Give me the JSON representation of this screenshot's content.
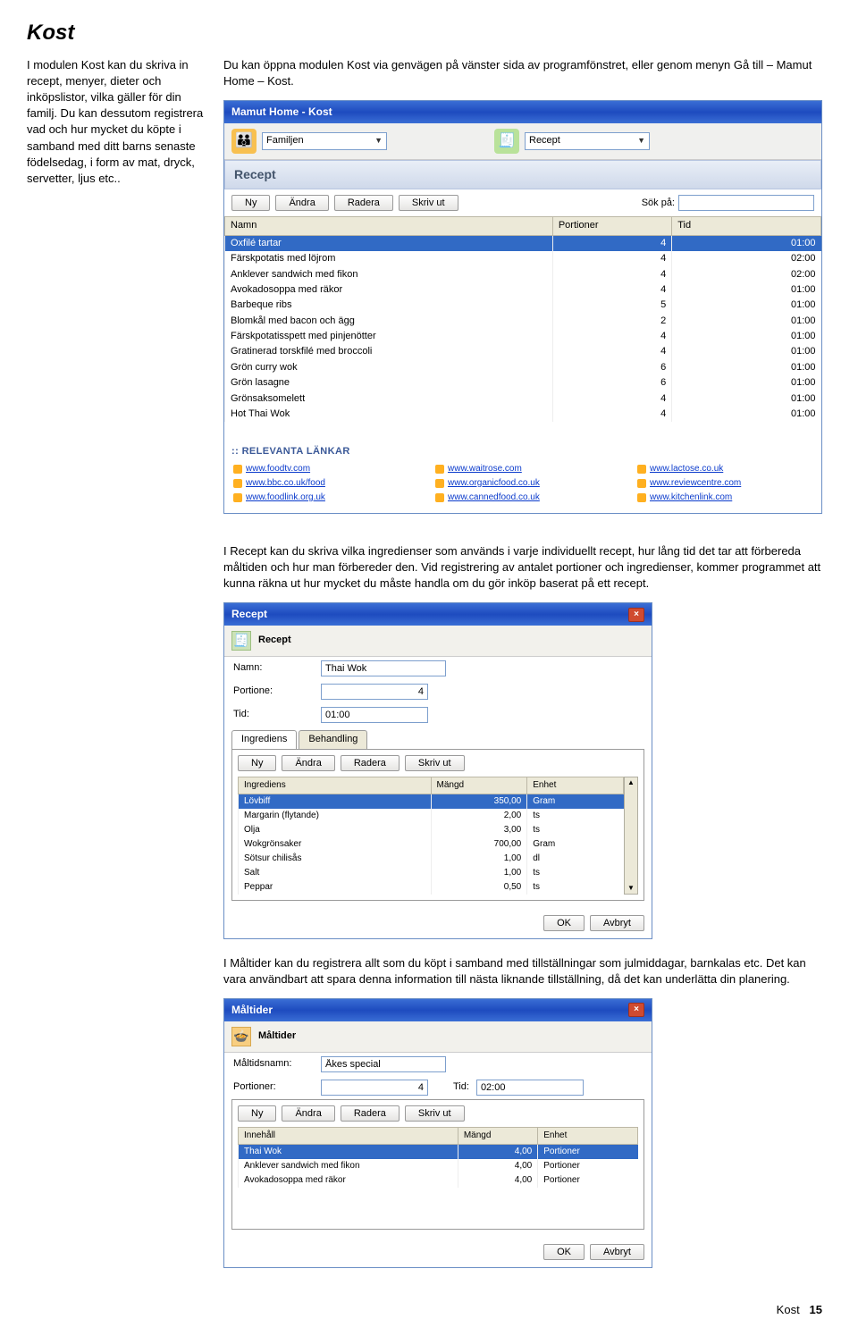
{
  "page": {
    "title": "Kost",
    "intro_left": "I modulen Kost kan du skriva in recept, menyer, dieter och inköpslistor, vilka gäller för din familj. Du kan dessutom registrera vad och hur mycket du köpte i samband med ditt barns senaste födelsedag, i form av mat, dryck, servetter, ljus etc..",
    "intro_right": "Du kan öppna modulen Kost via genvägen på vänster sida av programfönstret, eller genom menyn Gå till – Mamut Home – Kost.",
    "para_recept": "I Recept kan du skriva vilka ingredienser som används i varje individuellt recept, hur lång tid det tar att förbereda måltiden och hur man förbereder den. Vid registrering av antalet portioner och ingredienser, kommer programmet att kunna räkna ut hur mycket du måste handla om du gör inköp baserat på ett recept.",
    "para_maltider": "I Måltider kan du registrera allt som du köpt i samband med tillställningar som julmiddagar, barnkalas etc. Det kan vara användbart att spara denna information till nästa liknande tillställning, då det kan underlätta din planering.",
    "footer_module": "Kost",
    "footer_page": "15"
  },
  "win1": {
    "title": "Mamut Home - Kost",
    "sel_left": "Familjen",
    "sel_right": "Recept",
    "section": "Recept",
    "btns": {
      "ny": "Ny",
      "andra": "Ändra",
      "radera": "Radera",
      "skriv": "Skriv ut"
    },
    "search_label": "Sök på:",
    "cols": {
      "namn": "Namn",
      "port": "Portioner",
      "tid": "Tid"
    },
    "rows": [
      {
        "namn": "Oxfilé tartar",
        "port": "4",
        "tid": "01:00",
        "sel": true
      },
      {
        "namn": "Färskpotatis med löjrom",
        "port": "4",
        "tid": "02:00"
      },
      {
        "namn": "Anklever sandwich med fikon",
        "port": "4",
        "tid": "02:00"
      },
      {
        "namn": "Avokadosoppa med räkor",
        "port": "4",
        "tid": "01:00"
      },
      {
        "namn": "Barbeque ribs",
        "port": "5",
        "tid": "01:00"
      },
      {
        "namn": "Blomkål med bacon och ägg",
        "port": "2",
        "tid": "01:00"
      },
      {
        "namn": "Färskpotatisspett med pinjenötter",
        "port": "4",
        "tid": "01:00"
      },
      {
        "namn": "Gratinerad torskfilé med broccoli",
        "port": "4",
        "tid": "01:00"
      },
      {
        "namn": "Grön curry wok",
        "port": "6",
        "tid": "01:00"
      },
      {
        "namn": "Grön lasagne",
        "port": "6",
        "tid": "01:00"
      },
      {
        "namn": "Grönsaksomelett",
        "port": "4",
        "tid": "01:00"
      },
      {
        "namn": "Hot Thai Wok",
        "port": "4",
        "tid": "01:00"
      }
    ],
    "links_head": ":: RELEVANTA LÄNKAR",
    "links": [
      "www.foodtv.com",
      "www.waitrose.com",
      "www.lactose.co.uk",
      "www.bbc.co.uk/food",
      "www.organicfood.co.uk",
      "www.reviewcentre.com",
      "www.foodlink.org.uk",
      "www.cannedfood.co.uk",
      "www.kitchenlink.com"
    ]
  },
  "win2": {
    "title": "Recept",
    "section": "Recept",
    "labels": {
      "namn": "Namn:",
      "port": "Portione:",
      "tid": "Tid:"
    },
    "vals": {
      "namn": "Thai Wok",
      "port": "4",
      "tid": "01:00"
    },
    "tabs": {
      "ingred": "Ingrediens",
      "behand": "Behandling"
    },
    "btns": {
      "ny": "Ny",
      "andra": "Ändra",
      "radera": "Radera",
      "skriv": "Skriv ut",
      "ok": "OK",
      "avbryt": "Avbryt"
    },
    "cols": {
      "ingred": "Ingrediens",
      "mangd": "Mängd",
      "enhet": "Enhet"
    },
    "rows": [
      {
        "i": "Lövbiff",
        "m": "350,00",
        "e": "Gram",
        "sel": true
      },
      {
        "i": "Margarin (flytande)",
        "m": "2,00",
        "e": "ts"
      },
      {
        "i": "Olja",
        "m": "3,00",
        "e": "ts"
      },
      {
        "i": "Wokgrönsaker",
        "m": "700,00",
        "e": "Gram"
      },
      {
        "i": "Sötsur chilisås",
        "m": "1,00",
        "e": "dl"
      },
      {
        "i": "Salt",
        "m": "1,00",
        "e": "ts"
      },
      {
        "i": "Peppar",
        "m": "0,50",
        "e": "ts"
      }
    ]
  },
  "win3": {
    "title": "Måltider",
    "section": "Måltider",
    "labels": {
      "namn": "Måltidsnamn:",
      "port": "Portioner:",
      "tid": "Tid:"
    },
    "vals": {
      "namn": "Åkes special",
      "port": "4",
      "tid": "02:00"
    },
    "btns": {
      "ny": "Ny",
      "andra": "Ändra",
      "radera": "Radera",
      "skriv": "Skriv ut",
      "ok": "OK",
      "avbryt": "Avbryt"
    },
    "cols": {
      "innehall": "Innehåll",
      "mangd": "Mängd",
      "enhet": "Enhet"
    },
    "rows": [
      {
        "i": "Thai Wok",
        "m": "4,00",
        "e": "Portioner",
        "sel": true
      },
      {
        "i": "Anklever sandwich med fikon",
        "m": "4,00",
        "e": "Portioner"
      },
      {
        "i": "Avokadosoppa med räkor",
        "m": "4,00",
        "e": "Portioner"
      }
    ]
  }
}
